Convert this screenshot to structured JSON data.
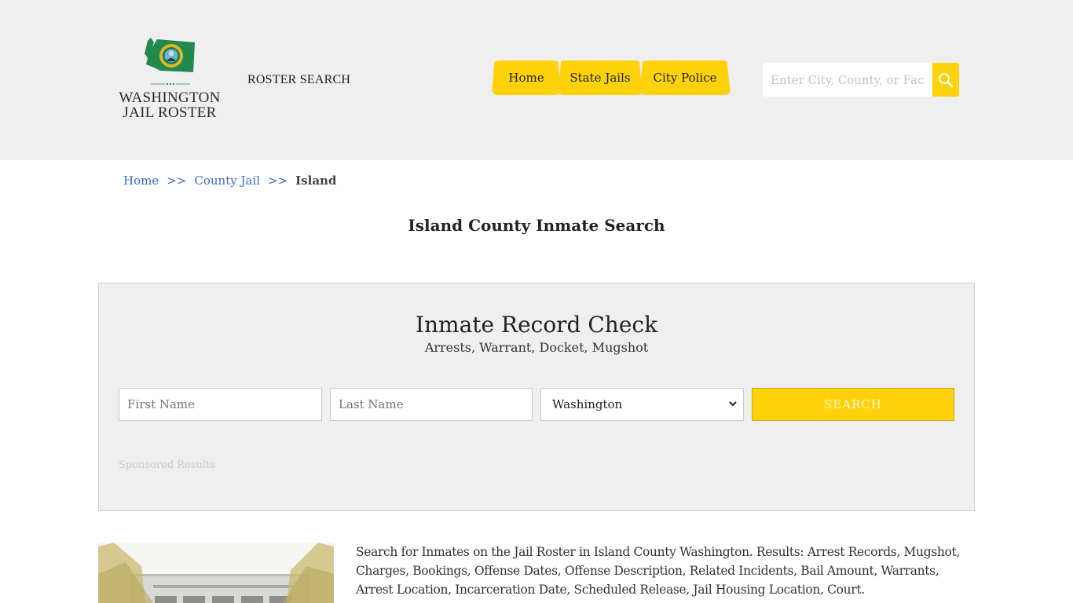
{
  "header": {
    "logo": {
      "line1": "WASHINGTON",
      "line2": "JAIL ROSTER",
      "icon": "washington-state-seal-map"
    },
    "roster_search_label": "ROSTER SEARCH",
    "nav": [
      {
        "label": "Home"
      },
      {
        "label": "State Jails"
      },
      {
        "label": "City Police"
      }
    ],
    "search": {
      "placeholder": "Enter City, County, or Facility",
      "button_icon": "search-icon"
    }
  },
  "breadcrumb": {
    "items": [
      {
        "label": "Home",
        "link": true
      },
      {
        "label": "County Jail",
        "link": true
      },
      {
        "label": "Island",
        "link": false
      }
    ],
    "separator": ">>"
  },
  "page_title": "Island County Inmate Search",
  "record_check": {
    "title": "Inmate Record Check",
    "subtitle": "Arrests, Warrant, Docket, Mugshot",
    "first_name_placeholder": "First Name",
    "last_name_placeholder": "Last Name",
    "state_selected": "Washington",
    "search_button": "SEARCH",
    "sponsored_label": "Sponsored Results"
  },
  "content": {
    "image_alt": "Island County jail building",
    "description": "Search for Inmates on the Jail Roster in Island County Washington. Results: Arrest Records, Mugshot, Charges, Bookings, Offense Dates, Offense Description, Related Incidents, Bail Amount, Warrants, Arrest Location, Incarceration Date, Scheduled Release, Jail Housing Location, Court."
  },
  "colors": {
    "accent_yellow": "#fdd20a",
    "header_bg": "#efefef",
    "link_blue": "#3a6bc9",
    "logo_green": "#1f8a4c"
  }
}
